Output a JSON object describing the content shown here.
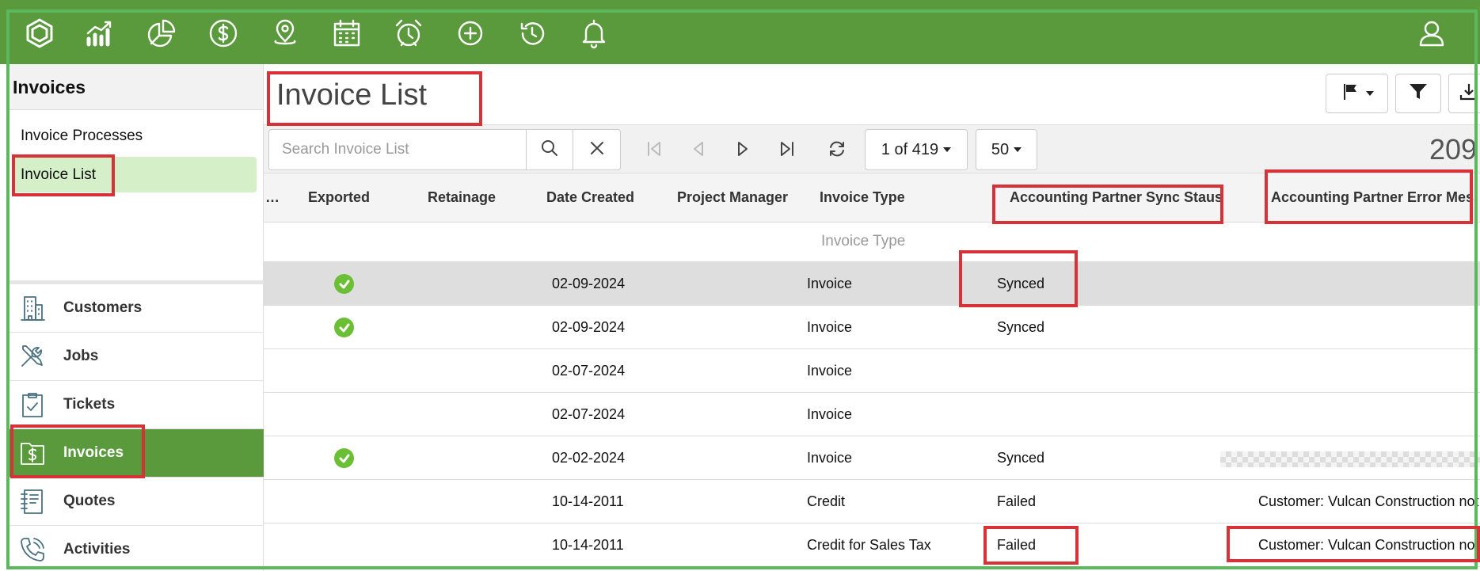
{
  "nav": {
    "icons": [
      "logo-hexagon-icon",
      "analytics-icon",
      "pie-chart-icon",
      "dollar-icon",
      "map-pin-icon",
      "calendar-icon",
      "alarm-clock-icon",
      "add-circle-icon",
      "history-icon",
      "bell-icon"
    ],
    "user_icon": "user-icon"
  },
  "sidebar": {
    "header": "Invoices",
    "sub_items": [
      {
        "label": "Invoice Processes",
        "active": false
      },
      {
        "label": "Invoice List",
        "active": true
      }
    ],
    "modules": [
      {
        "label": "Customers",
        "icon": "building-icon",
        "active": false
      },
      {
        "label": "Jobs",
        "icon": "tools-icon",
        "active": false
      },
      {
        "label": "Tickets",
        "icon": "clipboard-check-icon",
        "active": false
      },
      {
        "label": "Invoices",
        "icon": "folder-dollar-icon",
        "active": true
      },
      {
        "label": "Quotes",
        "icon": "notebook-icon",
        "active": false
      },
      {
        "label": "Activities",
        "icon": "phone-icon",
        "active": false
      }
    ]
  },
  "main": {
    "title": "Invoice List",
    "search_placeholder": "Search Invoice List",
    "page_indicator": "1 of 419",
    "page_size": "50",
    "total_count": "209",
    "columns": [
      "…",
      "Exported",
      "Retainage",
      "Date Created",
      "Project Manager",
      "Invoice Type",
      "Accounting Partner Sync Staus",
      "Accounting Partner Error Mes"
    ],
    "filter_placeholder": "Invoice Type",
    "rows": [
      {
        "exported": true,
        "date": "02-09-2024",
        "type": "Invoice",
        "sync": "Synced",
        "error": "",
        "selected": true
      },
      {
        "exported": true,
        "date": "02-09-2024",
        "type": "Invoice",
        "sync": "Synced",
        "error": "",
        "selected": false
      },
      {
        "exported": false,
        "date": "02-07-2024",
        "type": "Invoice",
        "sync": "",
        "error": "",
        "selected": false
      },
      {
        "exported": false,
        "date": "02-07-2024",
        "type": "Invoice",
        "sync": "",
        "error": "",
        "selected": false
      },
      {
        "exported": true,
        "date": "02-02-2024",
        "type": "Invoice",
        "sync": "Synced",
        "error": "",
        "blurred": true,
        "selected": false
      },
      {
        "exported": false,
        "date": "10-14-2011",
        "type": "Credit",
        "sync": "Failed",
        "error": "Customer: Vulcan Construction not",
        "selected": false
      },
      {
        "exported": false,
        "date": "10-14-2011",
        "type": "Credit for Sales Tax",
        "sync": "Failed",
        "error": "Customer: Vulcan Construction not",
        "selected": false
      }
    ]
  },
  "colors": {
    "nav_green": "#5a9a3c",
    "highlight_red": "#d63238",
    "check_green": "#6bbf35",
    "active_sub": "#d5efc9"
  }
}
